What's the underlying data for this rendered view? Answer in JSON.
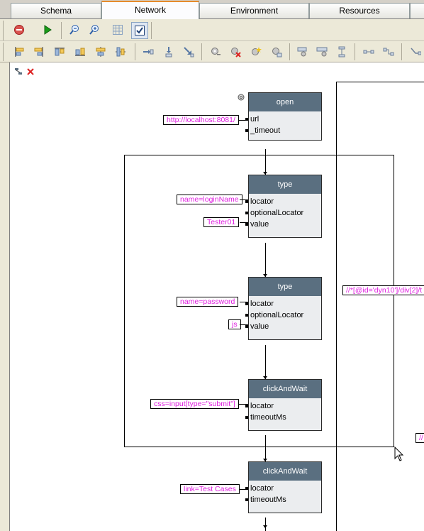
{
  "tabs": [
    "Schema",
    "Network",
    "Environment",
    "Resources"
  ],
  "toolbar": {
    "row1": [
      "stop-icon",
      "run-icon",
      "zoom-out-icon",
      "zoom-in-icon",
      "grid-icon",
      "checkbox-icon"
    ],
    "row2": [
      "align-left-icon",
      "align-right-icon",
      "align-top-icon",
      "align-bottom-icon",
      "align-hcenter-icon",
      "align-vcenter-icon",
      "insert-before-icon",
      "insert-below-icon",
      "move-down-icon",
      "gear-add-icon",
      "gear-remove-icon",
      "gear-star-icon",
      "gear-move-icon",
      "node-h-icon",
      "node-h2-icon",
      "node-v-icon",
      "link-icon",
      "link2-icon",
      "route-icon"
    ]
  },
  "nodes": [
    {
      "title": "open",
      "ports": [
        "url",
        "_timeout"
      ]
    },
    {
      "title": "type",
      "ports": [
        "locator",
        "optionalLocator",
        "value"
      ]
    },
    {
      "title": "type",
      "ports": [
        "locator",
        "optionalLocator",
        "value"
      ]
    },
    {
      "title": "clickAndWait",
      "ports": [
        "locator",
        "timeoutMs"
      ]
    },
    {
      "title": "clickAndWait",
      "ports": [
        "locator",
        "timeoutMs"
      ]
    }
  ],
  "values": {
    "open_url": "http://localhost:8081/",
    "type1_locator": "name=loginName",
    "type1_value": "Tester01",
    "type2_locator": "name=password",
    "type2_value": "js",
    "click1_locator": "css=input[type=\"submit\"]",
    "click2_locator": "link=Test Cases",
    "xpath_right": "//*[@id='dyn10']/div[2]/t",
    "xpath_right2": "//"
  },
  "colors": {
    "node_header": "#5a6f80",
    "node_body": "#ebedef",
    "value_text": "#e01ee0",
    "active_tab_accent": "#e68b2c"
  }
}
